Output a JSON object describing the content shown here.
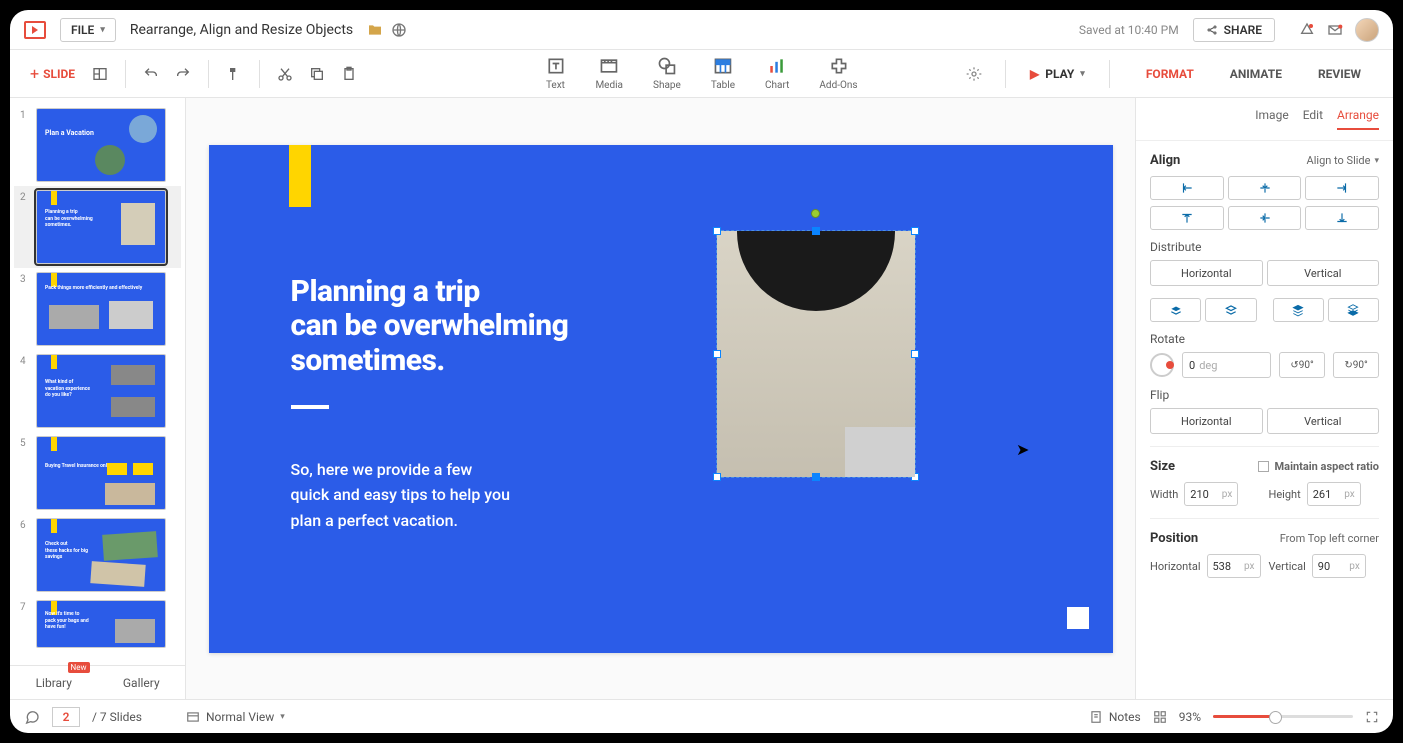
{
  "top": {
    "file_menu": "FILE",
    "doc_title": "Rearrange, Align and Resize Objects",
    "saved": "Saved at 10:40 PM",
    "share": "SHARE"
  },
  "toolbar": {
    "new_slide": "SLIDE",
    "insert": {
      "text": "Text",
      "media": "Media",
      "shape": "Shape",
      "table": "Table",
      "chart": "Chart",
      "addons": "Add-Ons"
    },
    "play": "PLAY",
    "modes": {
      "format": "FORMAT",
      "animate": "ANIMATE",
      "review": "REVIEW"
    }
  },
  "thumbs": {
    "count": 7,
    "sel": 2,
    "library": "Library",
    "gallery": "Gallery",
    "new_badge": "New",
    "t1_title": "Plan a Vacation",
    "t2_a": "Planning a trip",
    "t2_b": "can be overwhelming",
    "t2_c": "sometimes.",
    "t3": "Pack things more efficiently and effectively",
    "t4_a": "What kind of",
    "t4_b": "vacation experience",
    "t4_c": "do you like?",
    "t5": "Buying Travel Insurance online",
    "t6_a": "Check out",
    "t6_b": "these hacks for big",
    "t6_c": "savings",
    "t7_a": "Now it's time to",
    "t7_b": "pack your bags and",
    "t7_c": "have fun!"
  },
  "slide": {
    "title": "Planning a trip\ncan be overwhelming\nsometimes.",
    "body": "So, here we provide a few\nquick and easy tips to help you\nplan a perfect vacation."
  },
  "panel": {
    "tabs": {
      "image": "Image",
      "edit": "Edit",
      "arrange": "Arrange"
    },
    "align": {
      "title": "Align",
      "to": "Align to Slide"
    },
    "distribute": {
      "title": "Distribute",
      "h": "Horizontal",
      "v": "Vertical"
    },
    "rotate": {
      "title": "Rotate",
      "value": "0",
      "unit": "deg",
      "r1": "90°",
      "r2": "90°"
    },
    "flip": {
      "title": "Flip",
      "h": "Horizontal",
      "v": "Vertical"
    },
    "size": {
      "title": "Size",
      "aspect": "Maintain aspect ratio",
      "w_label": "Width",
      "w": "210",
      "h_label": "Height",
      "h": "261",
      "unit": "px"
    },
    "position": {
      "title": "Position",
      "from": "From Top left corner",
      "h_label": "Horizontal",
      "h": "538",
      "v_label": "Vertical",
      "v": "90",
      "unit": "px"
    }
  },
  "status": {
    "current": "2",
    "total": "/ 7 Slides",
    "view": "Normal View",
    "notes": "Notes",
    "zoom": "93%"
  }
}
